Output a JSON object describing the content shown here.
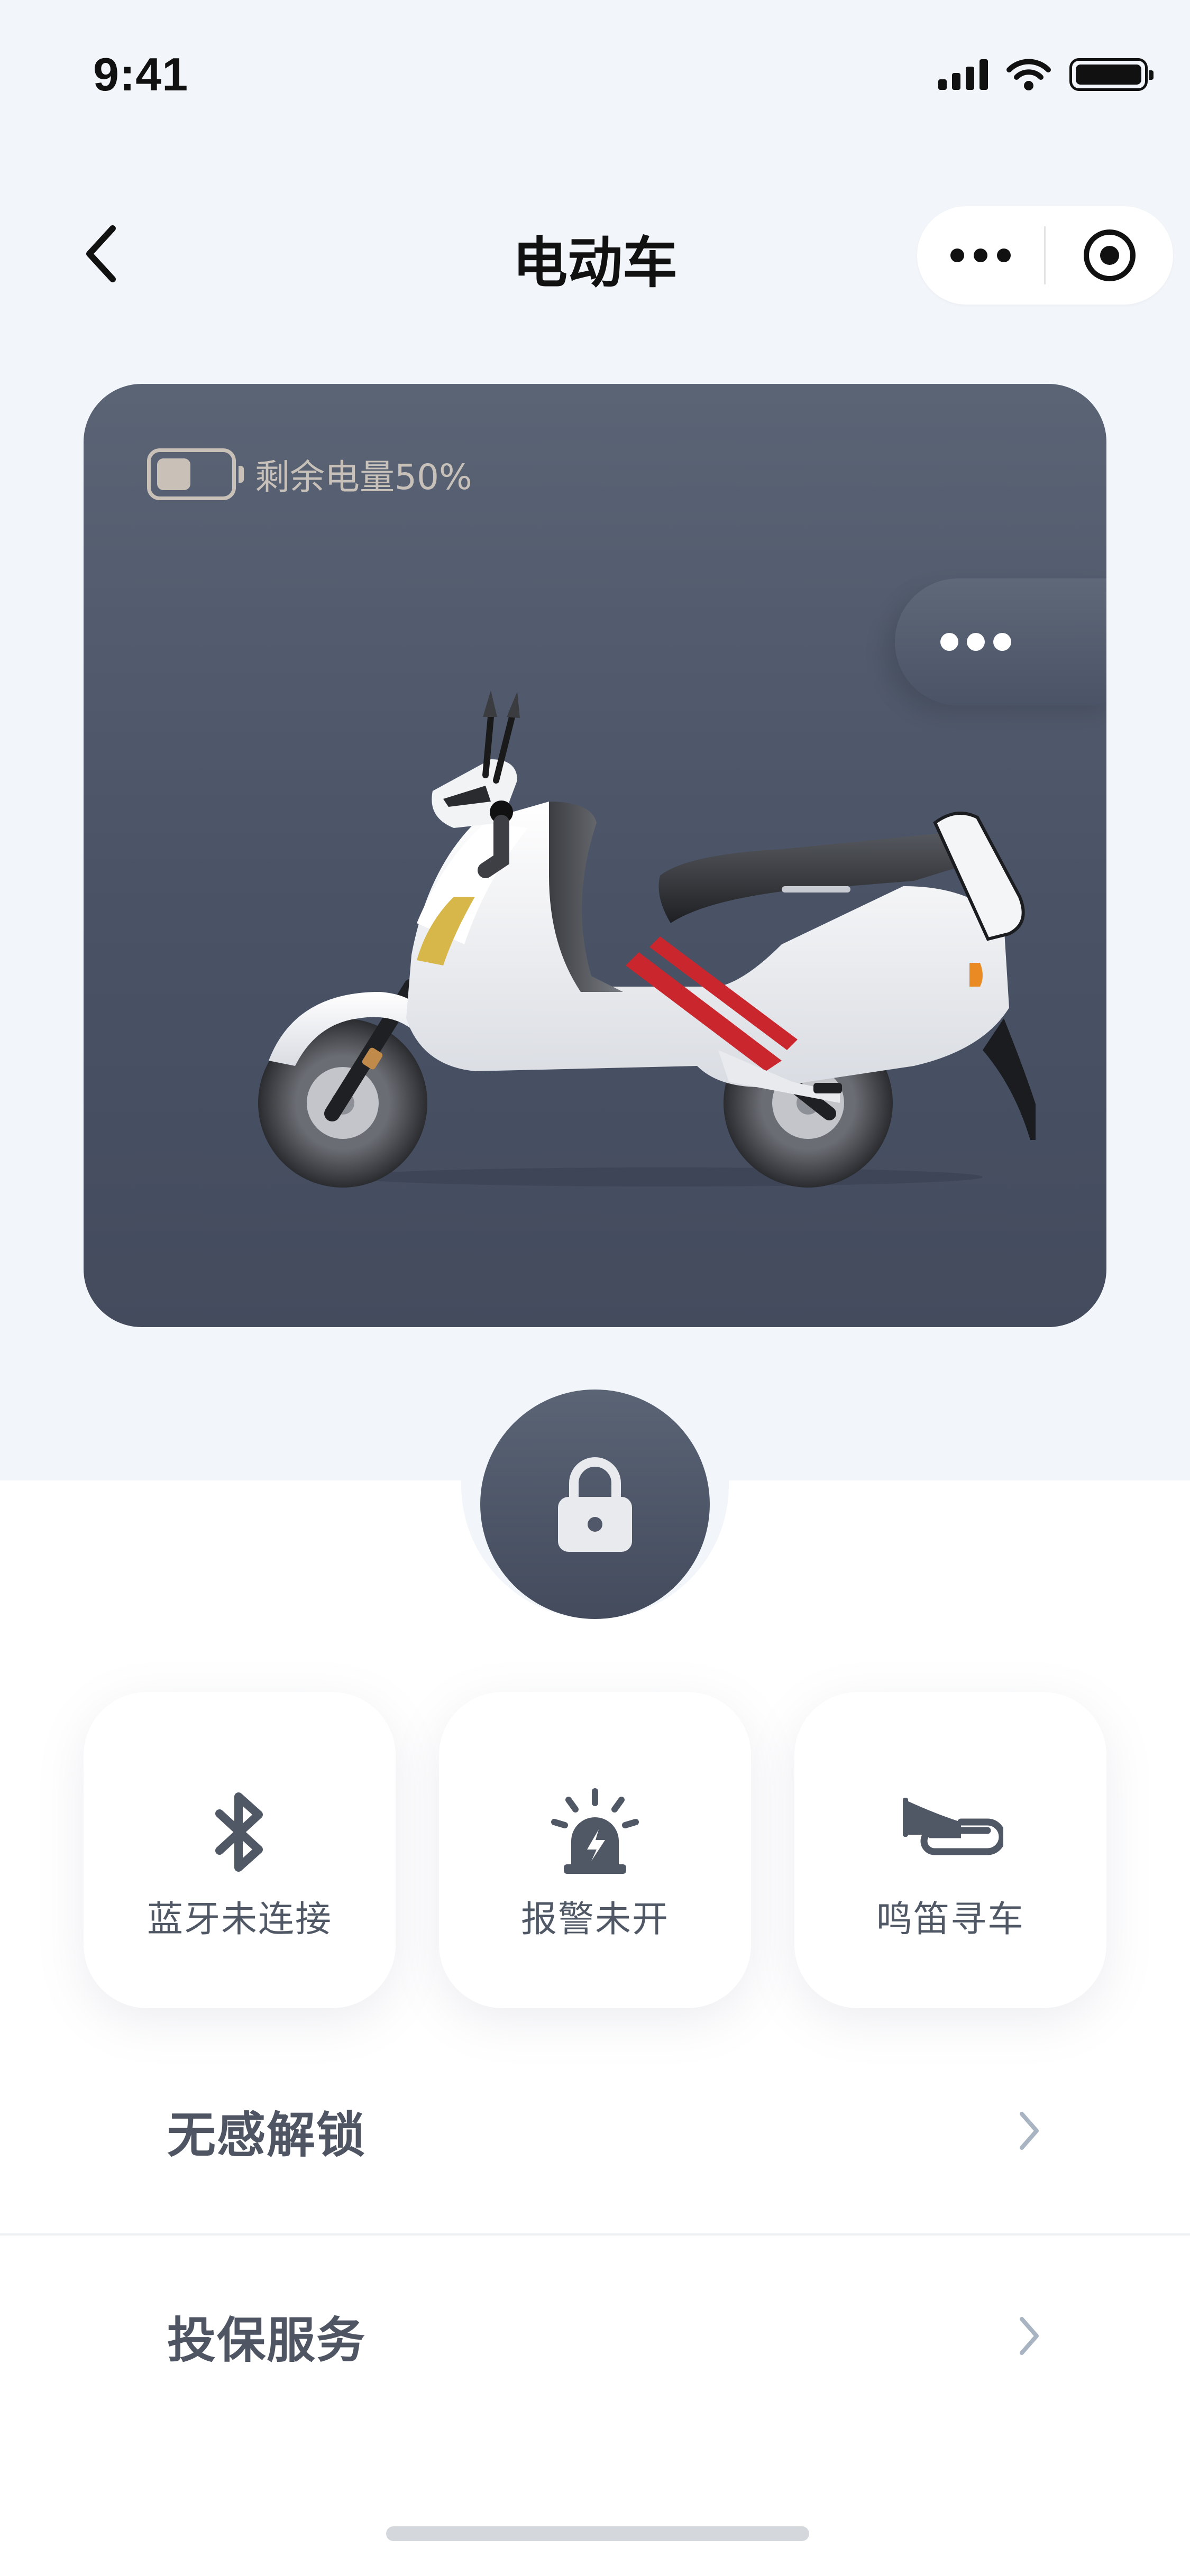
{
  "status_bar": {
    "time": "9:41"
  },
  "header": {
    "title": "电动车"
  },
  "vehicle": {
    "battery_percent": 50,
    "battery_text": "剩余电量50%",
    "accent_color": "#c9262d"
  },
  "lock": {
    "state": "locked"
  },
  "quick_actions": [
    {
      "label": "蓝牙未连接",
      "icon": "bluetooth-icon"
    },
    {
      "label": "报警未开",
      "icon": "alarm-icon"
    },
    {
      "label": "鸣笛寻车",
      "icon": "horn-icon"
    }
  ],
  "menu": [
    {
      "label": "无感解锁"
    },
    {
      "label": "投保服务"
    }
  ],
  "colors": {
    "card": "#4d5668",
    "background": "#f2f5f9",
    "text": "#4f5563",
    "chevron": "#a9b4c2"
  }
}
